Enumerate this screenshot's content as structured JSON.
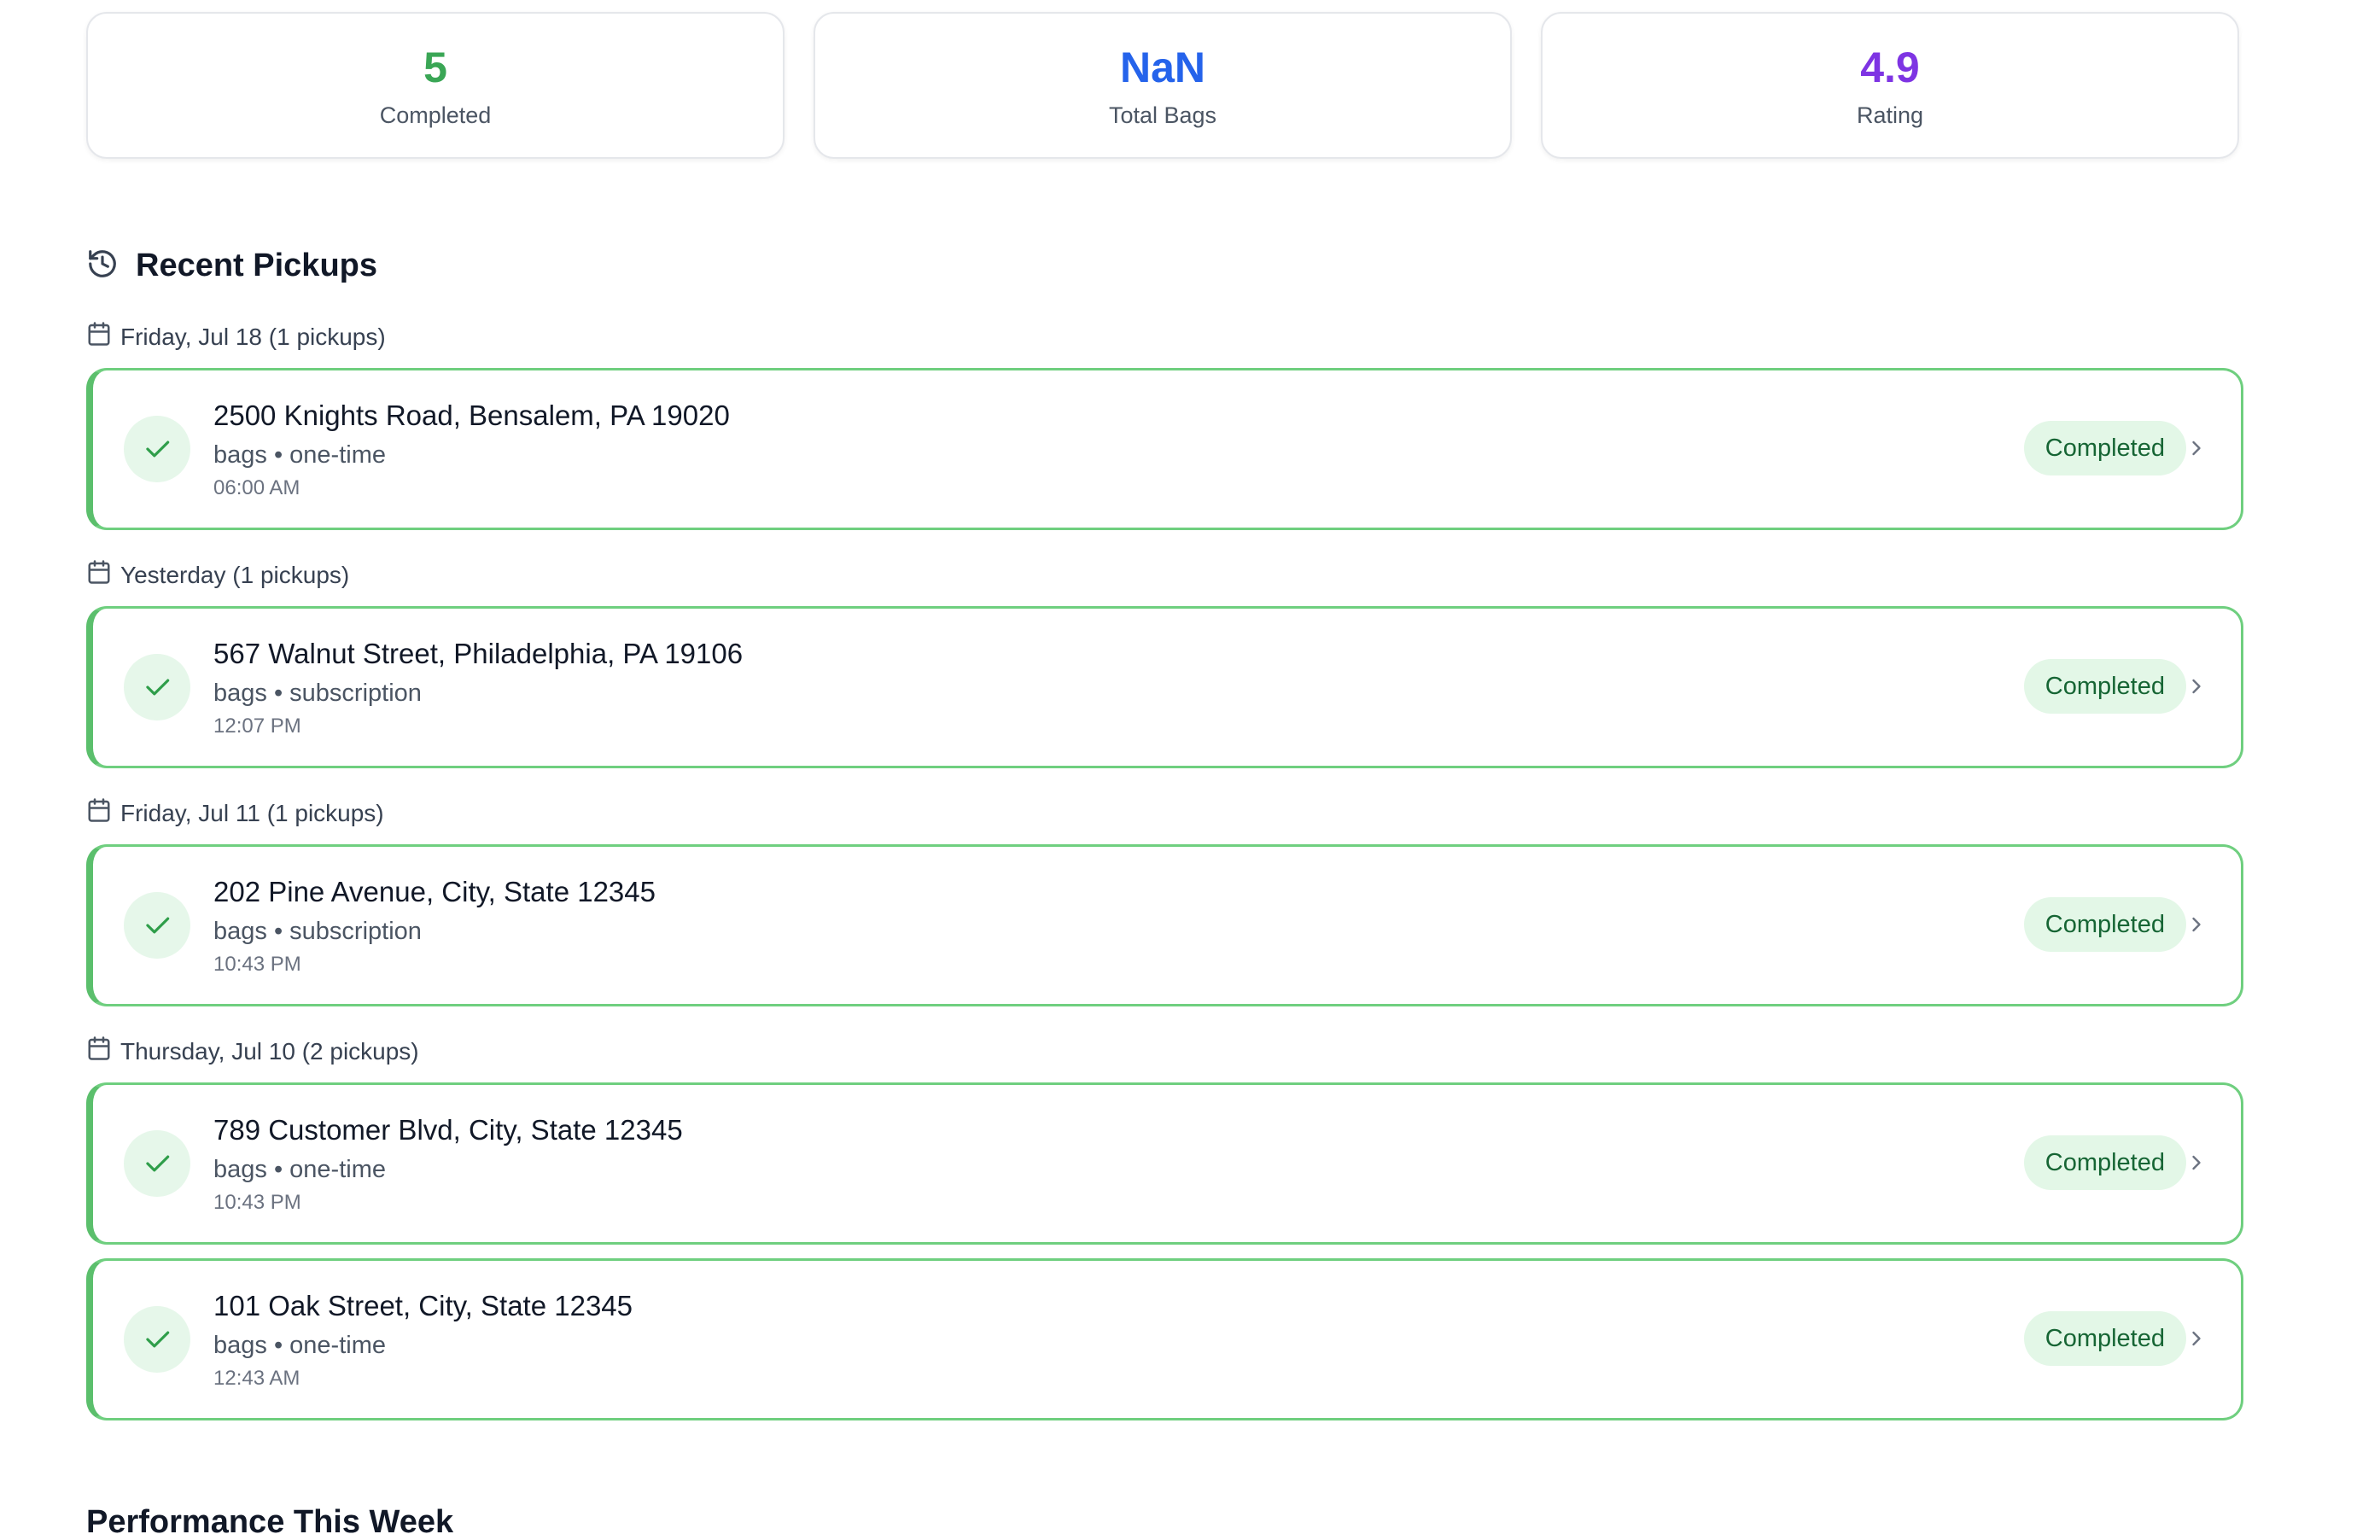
{
  "stats": [
    {
      "value": "5",
      "label": "Completed",
      "color": "#3aa655"
    },
    {
      "value": "NaN",
      "label": "Total Bags",
      "color": "#2563eb"
    },
    {
      "value": "4.9",
      "label": "Rating",
      "color": "#7e34e3"
    }
  ],
  "recent": {
    "title": "Recent Pickups",
    "icon": "history-icon"
  },
  "groups": [
    {
      "label": "Friday, Jul 18 (1 pickups)"
    },
    {
      "label": "Yesterday (1 pickups)"
    },
    {
      "label": "Friday, Jul 11 (1 pickups)"
    },
    {
      "label": "Thursday, Jul 10 (2 pickups)"
    }
  ],
  "pickups": [
    {
      "address": "2500 Knights Road, Bensalem, PA 19020",
      "meta": "bags • one-time",
      "time": "06:00 AM",
      "status": "Completed"
    },
    {
      "address": "567 Walnut Street, Philadelphia, PA 19106",
      "meta": "bags • subscription",
      "time": "12:07 PM",
      "status": "Completed"
    },
    {
      "address": "202 Pine Avenue, City, State 12345",
      "meta": "bags • subscription",
      "time": "10:43 PM",
      "status": "Completed"
    },
    {
      "address": "789 Customer Blvd, City, State 12345",
      "meta": "bags • one-time",
      "time": "10:43 PM",
      "status": "Completed"
    },
    {
      "address": "101 Oak Street, City, State 12345",
      "meta": "bags • one-time",
      "time": "12:43 AM",
      "status": "Completed"
    }
  ],
  "performance": {
    "title": "Performance This Week"
  },
  "colors": {
    "accent_green": "#5bbf6c",
    "badge_bg": "#e3f7e7",
    "badge_text": "#166534"
  }
}
